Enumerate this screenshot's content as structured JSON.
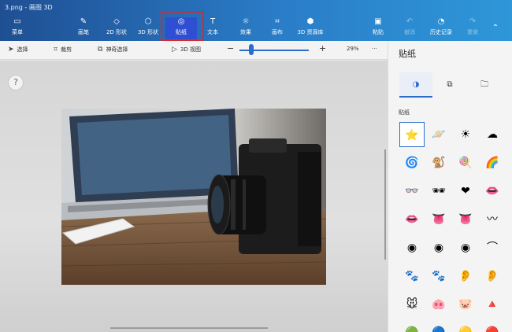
{
  "window": {
    "title": "3.png - 画图 3D",
    "controls": [
      "—",
      "□",
      "✕"
    ]
  },
  "ribbon": {
    "menu": "菜单",
    "tools": [
      {
        "label": "画笔",
        "icon": "brush-icon"
      },
      {
        "label": "2D 形状",
        "icon": "2d-shapes-icon"
      },
      {
        "label": "3D 形状",
        "icon": "3d-shapes-icon"
      },
      {
        "label": "贴纸",
        "icon": "stickers-icon",
        "selected": true
      },
      {
        "label": "文本",
        "icon": "text-icon"
      },
      {
        "label": "效果",
        "icon": "effects-icon"
      },
      {
        "label": "画布",
        "icon": "canvas-icon"
      },
      {
        "label": "3D 资源库",
        "icon": "3d-library-icon"
      }
    ],
    "right": [
      {
        "label": "粘贴",
        "icon": "paste-icon",
        "enabled": true
      },
      {
        "label": "撤消",
        "icon": "undo-icon",
        "enabled": false
      },
      {
        "label": "历史记录",
        "icon": "history-icon",
        "enabled": true
      },
      {
        "label": "重做",
        "icon": "redo-icon",
        "enabled": false
      }
    ]
  },
  "subbar": {
    "select": "选择",
    "crop": "裁剪",
    "magic_select": "神奇选择",
    "view3d": "3D 视图",
    "zoom": "29%",
    "zoom_value": 29,
    "more": "···"
  },
  "panel": {
    "title": "贴纸",
    "section": "贴纸",
    "tabs": [
      "stickers-tab-icon",
      "textures-tab-icon",
      "custom-folder-icon"
    ],
    "stickers": [
      "⭐",
      "🪐",
      "☀",
      "☁",
      "🌀",
      "🐒",
      "🍭",
      "🌈",
      "👓",
      "🕶",
      "❤",
      "👄",
      "👄",
      "👅",
      "👅",
      "〰",
      "◉",
      "◉",
      "◉",
      "⌒",
      "🐾",
      "🐾",
      "👂",
      "👂",
      "🐭",
      "🐽",
      "🐷",
      "🔺",
      "🟢",
      "🔵",
      "🟡",
      "🔴"
    ],
    "selected_index": 0
  },
  "colors": {
    "accent": "#2a6dcb",
    "highlight": "#e0262a"
  }
}
